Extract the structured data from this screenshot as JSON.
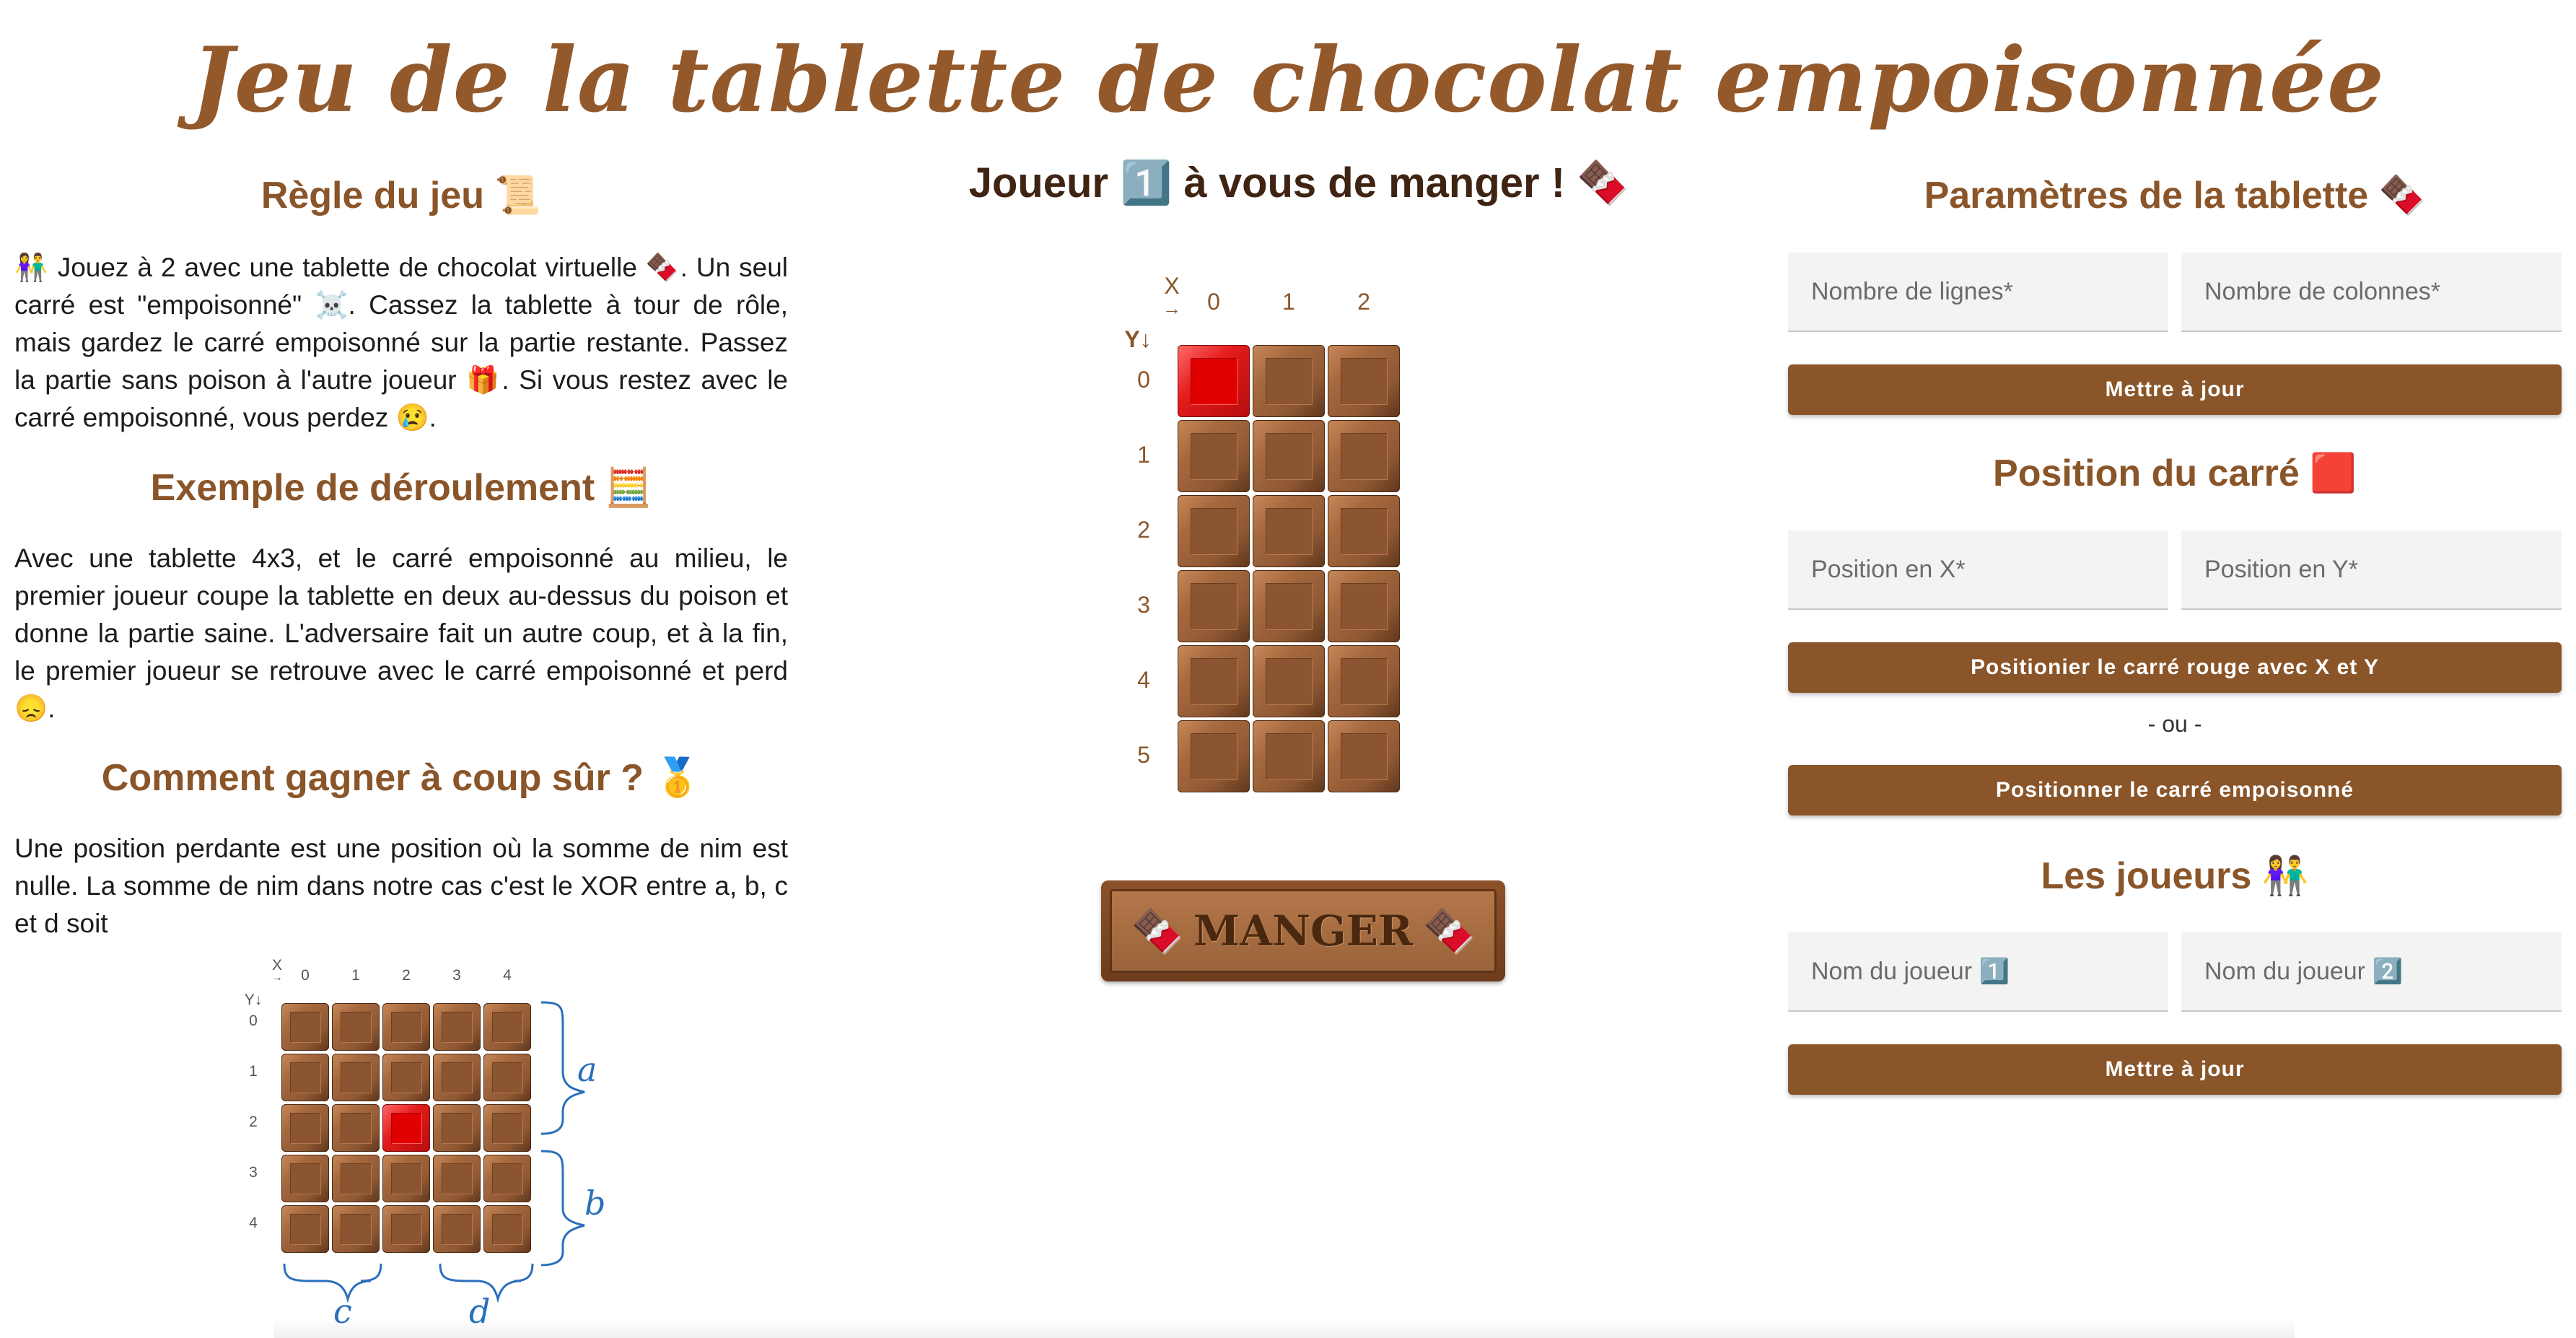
{
  "title": "Jeu de la tablette de chocolat empoisonnée",
  "rules": {
    "heading": "Règle du jeu 📜",
    "text": "👫 Jouez à 2 avec une tablette de chocolat virtuelle 🍫. Un seul carré est \"empoisonné\" ☠️. Cassez la tablette à tour de rôle, mais gardez le carré empoisonné sur la partie restante. Passez la partie sans poison à l'autre joueur 🎁. Si vous restez avec le carré empoisonné, vous perdez 😢."
  },
  "example": {
    "heading": "Exemple de déroulement 🧮",
    "text": "Avec une tablette 4x3, et le carré empoisonné au milieu, le premier joueur coupe la tablette en deux au-dessus du poison et donne la partie saine. L'adversaire fait un autre coup, et à la fin, le premier joueur se retrouve avec le carré empoisonné et perd 😞."
  },
  "strategy": {
    "heading": "Comment gagner à coup sûr ? 🥇",
    "text": "Une position perdante est une position où la somme de nim est nulle. La somme de nim dans notre cas c'est le XOR entre a, b, c et d soit",
    "diagram": {
      "x_label": "X",
      "x_arrow": "→",
      "y_label": "Y↓",
      "cols": [
        "0",
        "1",
        "2",
        "3",
        "4"
      ],
      "rows": [
        "0",
        "1",
        "2",
        "3",
        "4"
      ],
      "poison": {
        "col": 2,
        "row": 2
      },
      "labels": {
        "a": "a",
        "b": "b",
        "c": "c",
        "d": "d"
      }
    }
  },
  "board": {
    "turn_text": "Joueur 1️⃣ à vous de manger ! 🍫",
    "x_label": "X",
    "x_arrow": "→",
    "y_label": "Y↓",
    "cols": [
      "0",
      "1",
      "2"
    ],
    "rows": [
      "0",
      "1",
      "2",
      "3",
      "4",
      "5"
    ],
    "poison": {
      "col": 0,
      "row": 0
    },
    "eat_button": "MANGER",
    "eat_icon": "🍫"
  },
  "settings": {
    "heading": "Paramètres de la tablette 🍫",
    "rows_placeholder": "Nombre de lignes*",
    "cols_placeholder": "Nombre de colonnes*",
    "update_button": "Mettre à jour"
  },
  "position": {
    "heading": "Position du carré 🟥",
    "x_placeholder": "Position en X*",
    "y_placeholder": "Position en Y*",
    "set_button": "Positionier le carré rouge avec X et Y",
    "or_text": "- ou -",
    "poison_button": "Positionner le carré empoisonné"
  },
  "players": {
    "heading": "Les joueurs 👫",
    "p1_placeholder": "Nom du joueur 1️⃣",
    "p2_placeholder": "Nom du joueur 2️⃣",
    "update_button": "Mettre à jour"
  },
  "colors": {
    "accent": "#8a5529",
    "chocolate": "#8f5833",
    "poison": "#e41c1c"
  }
}
